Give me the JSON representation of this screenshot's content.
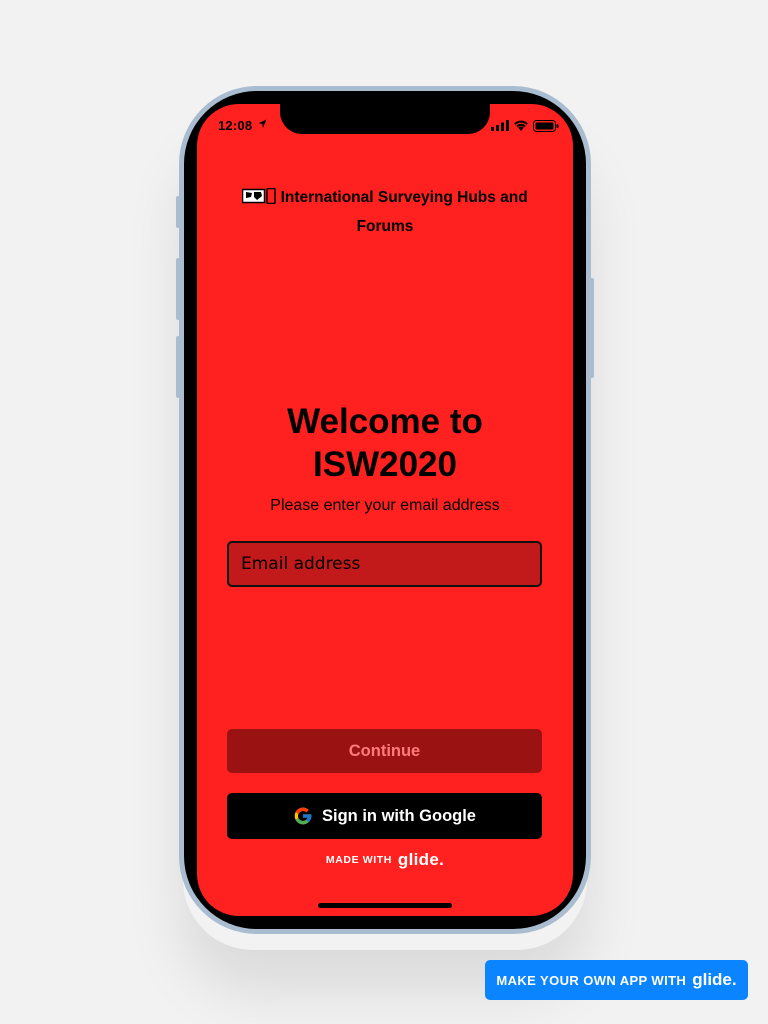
{
  "status_bar": {
    "time": "12:08",
    "icons": [
      "location-arrow-icon",
      "signal-icon",
      "wifi-icon",
      "battery-icon"
    ]
  },
  "app": {
    "title_emoji": "🗺️📱",
    "title": "International Surveying Hubs and Forums"
  },
  "welcome": {
    "heading": "Welcome to ISW2020",
    "instructions": "Please enter your email address"
  },
  "form": {
    "email_placeholder": "Email address",
    "email_value": "",
    "continue_label": "Continue",
    "google_label": "Sign in with Google"
  },
  "footer": {
    "made_with_label": "MADE WITH",
    "brand": "glide."
  },
  "promo": {
    "label": "MAKE YOUR OWN APP WITH",
    "brand": "glide."
  },
  "colors": {
    "page_background": "#f2f2f2",
    "screen_background": "#ff2020",
    "continue_button": "#9b1212",
    "continue_text": "#ff7b7b",
    "google_button": "#000000",
    "promo_button": "#0a84ff",
    "phone_frame": "#a9bcd0"
  }
}
